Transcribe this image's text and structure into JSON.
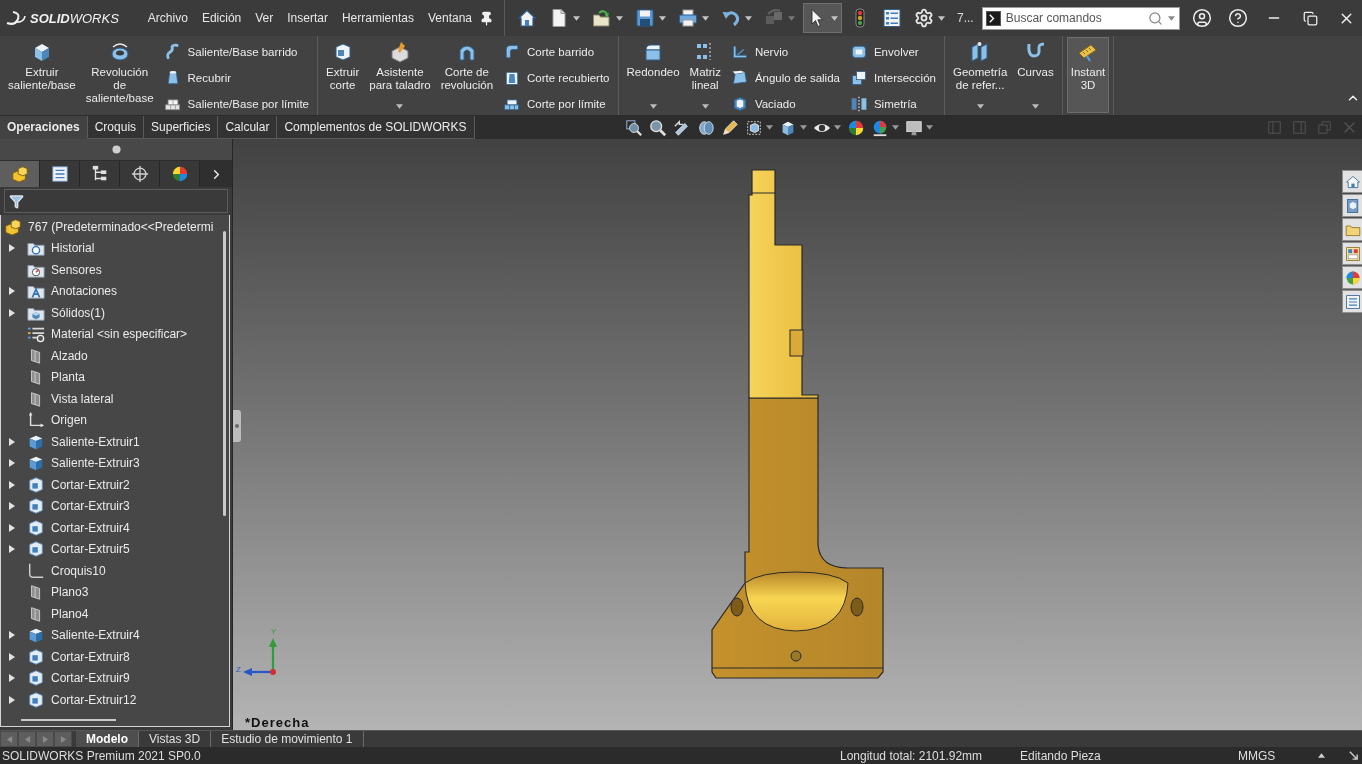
{
  "title_bar": {
    "logo_text": "**SOLID**WORKS",
    "menu": [
      "Archivo",
      "Edición",
      "Ver",
      "Insertar",
      "Herramientas",
      "Ventana"
    ],
    "quick_access": [
      {
        "kind": "home",
        "dropdown": false,
        "disabled": false,
        "pressed": false
      },
      {
        "kind": "new",
        "dropdown": true,
        "disabled": false,
        "pressed": false
      },
      {
        "kind": "open",
        "dropdown": true,
        "disabled": false,
        "pressed": false
      },
      {
        "kind": "save",
        "dropdown": true,
        "disabled": false,
        "pressed": false
      },
      {
        "kind": "print",
        "dropdown": true,
        "disabled": false,
        "pressed": false
      },
      {
        "kind": "undo",
        "dropdown": true,
        "disabled": false,
        "pressed": false
      },
      {
        "kind": "rebuild",
        "dropdown": true,
        "disabled": true,
        "pressed": false
      },
      {
        "kind": "select",
        "dropdown": true,
        "disabled": false,
        "pressed": true
      },
      {
        "kind": "stoplight",
        "dropdown": false,
        "disabled": false,
        "pressed": false
      },
      {
        "kind": "list",
        "dropdown": false,
        "disabled": false,
        "pressed": false
      },
      {
        "kind": "gear",
        "dropdown": true,
        "disabled": false,
        "pressed": false
      }
    ],
    "overflow_label": "7...",
    "search": {
      "placeholder": "Buscar comandos"
    }
  },
  "ribbon": {
    "groups": [
      {
        "items": [
          {
            "kind": "large",
            "label": "Extruir\nsaliente/base",
            "dropdown": false,
            "pressed": false
          },
          {
            "kind": "large",
            "label": "Revolución\nde\nsaliente/base",
            "dropdown": false,
            "pressed": false
          },
          {
            "kind": "stack",
            "buttons": [
              "Saliente/Base barrido",
              "Recubrir",
              "Saliente/Base por límite"
            ]
          }
        ]
      },
      {
        "items": [
          {
            "kind": "large",
            "label": "Extruir\ncorte",
            "dropdown": false,
            "pressed": false
          },
          {
            "kind": "large",
            "label": "Asistente\npara taladro",
            "dropdown": true,
            "pressed": false
          },
          {
            "kind": "large",
            "label": "Corte de\nrevolución",
            "dropdown": false,
            "pressed": false
          },
          {
            "kind": "stack",
            "buttons": [
              "Corte barrido",
              "Corte recubierto",
              "Corte por límite"
            ]
          }
        ]
      },
      {
        "items": [
          {
            "kind": "large",
            "label": "Redondeo",
            "dropdown": true,
            "pressed": false
          },
          {
            "kind": "large",
            "label": "Matriz\nlineal",
            "dropdown": true,
            "pressed": false
          },
          {
            "kind": "stack",
            "buttons": [
              "Nervio",
              "Ángulo de salida",
              "Vaciado"
            ]
          },
          {
            "kind": "stack",
            "buttons": [
              "Envolver",
              "Intersección",
              "Simetría"
            ]
          }
        ]
      },
      {
        "items": [
          {
            "kind": "large",
            "label": "Geometría\nde refer...",
            "dropdown": true,
            "pressed": false
          },
          {
            "kind": "large",
            "label": "Curvas",
            "dropdown": true,
            "pressed": false
          }
        ]
      },
      {
        "items": [
          {
            "kind": "large",
            "label": "Instant\n3D",
            "dropdown": false,
            "pressed": true
          }
        ]
      }
    ]
  },
  "ribbon_tabs": [
    {
      "label": "Operaciones",
      "selected": true
    },
    {
      "label": "Croquis",
      "selected": false
    },
    {
      "label": "Superficies",
      "selected": false
    },
    {
      "label": "Calcular",
      "selected": false
    },
    {
      "label": "Complementos de SOLIDWORKS",
      "selected": false
    }
  ],
  "feature_manager": {
    "panel_tabs": [
      {
        "kind": "feature-tree",
        "selected": true
      },
      {
        "kind": "property",
        "selected": false
      },
      {
        "kind": "configuration",
        "selected": false
      },
      {
        "kind": "dimxpert",
        "selected": false
      },
      {
        "kind": "display",
        "selected": false
      }
    ],
    "tree": {
      "label": "767 (Predeterminado<<Predetermi",
      "kind": "part",
      "children": [
        {
          "label": "Historial",
          "kind": "history",
          "expandable": true
        },
        {
          "label": "Sensores",
          "kind": "sensors",
          "expandable": false
        },
        {
          "label": "Anotaciones",
          "kind": "annotations",
          "expandable": true
        },
        {
          "label": "Sólidos(1)",
          "kind": "solids",
          "expandable": true
        },
        {
          "label": "Material <sin especificar>",
          "kind": "material",
          "expandable": false
        },
        {
          "label": "Alzado",
          "kind": "plane",
          "expandable": false
        },
        {
          "label": "Planta",
          "kind": "plane",
          "expandable": false
        },
        {
          "label": "Vista lateral",
          "kind": "plane",
          "expandable": false
        },
        {
          "label": "Origen",
          "kind": "origin",
          "expandable": false
        },
        {
          "label": "Saliente-Extruir1",
          "kind": "boss",
          "expandable": true
        },
        {
          "label": "Saliente-Extruir3",
          "kind": "boss",
          "expandable": true
        },
        {
          "label": "Cortar-Extruir2",
          "kind": "cut",
          "expandable": true
        },
        {
          "label": "Cortar-Extruir3",
          "kind": "cut",
          "expandable": true
        },
        {
          "label": "Cortar-Extruir4",
          "kind": "cut",
          "expandable": true
        },
        {
          "label": "Cortar-Extruir5",
          "kind": "cut",
          "expandable": true
        },
        {
          "label": "Croquis10",
          "kind": "sketch",
          "expandable": false
        },
        {
          "label": "Plano3",
          "kind": "plane",
          "expandable": false
        },
        {
          "label": "Plano4",
          "kind": "plane",
          "expandable": false
        },
        {
          "label": "Saliente-Extruir4",
          "kind": "boss",
          "expandable": true
        },
        {
          "label": "Cortar-Extruir8",
          "kind": "cut",
          "expandable": true
        },
        {
          "label": "Cortar-Extruir9",
          "kind": "cut",
          "expandable": true
        },
        {
          "label": "Cortar-Extruir12",
          "kind": "cut",
          "expandable": true
        }
      ]
    }
  },
  "viewport": {
    "view_label": "*Derecha",
    "triad": {
      "y_label": "Y",
      "z_label": "Z"
    }
  },
  "bottom_tabs": [
    {
      "label": "Modelo",
      "selected": true
    },
    {
      "label": "Vistas 3D",
      "selected": false
    },
    {
      "label": "Estudio de movimiento 1",
      "selected": false
    }
  ],
  "status_bar": {
    "product": "SOLIDWORKS Premium 2021 SP0.0",
    "total_length": "Longitud total: 2101.92mm",
    "mode": "Editando Pieza",
    "units": "MMGS"
  }
}
